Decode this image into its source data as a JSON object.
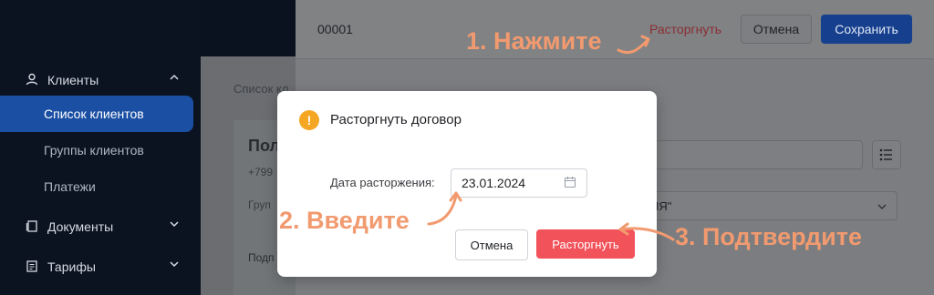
{
  "sidebar": {
    "clients_label": "Клиенты",
    "items": [
      {
        "label": "Список клиентов"
      },
      {
        "label": "Группы клиентов"
      },
      {
        "label": "Платежи"
      }
    ],
    "documents_label": "Документы",
    "tariffs_label": "Тарифы"
  },
  "page": {
    "breadcrumb": "Список кл",
    "card_title": "Пол",
    "card_phone": "+799",
    "card_group": "Груп",
    "card_extra": "Подп"
  },
  "drawer": {
    "contract_number": "00001",
    "terminate_link": "Расторгнуть",
    "cancel_label": "Отмена",
    "save_label": "Сохранить",
    "select_value": "ИЯ\""
  },
  "modal": {
    "title": "Расторгнуть договор",
    "date_label": "Дата расторжения",
    "date_value": "23.01.2024",
    "cancel_label": "Отмена",
    "confirm_label": "Расторгнуть",
    "warn_symbol": "!"
  },
  "annotations": {
    "step1": "1. Нажмите",
    "step2": "2. Введите",
    "step3": "3. Подтвердите"
  },
  "colors": {
    "accent": "#1a4fa3",
    "danger": "#f2525a",
    "annotation": "#f29a6f",
    "warning": "#f5a623"
  }
}
